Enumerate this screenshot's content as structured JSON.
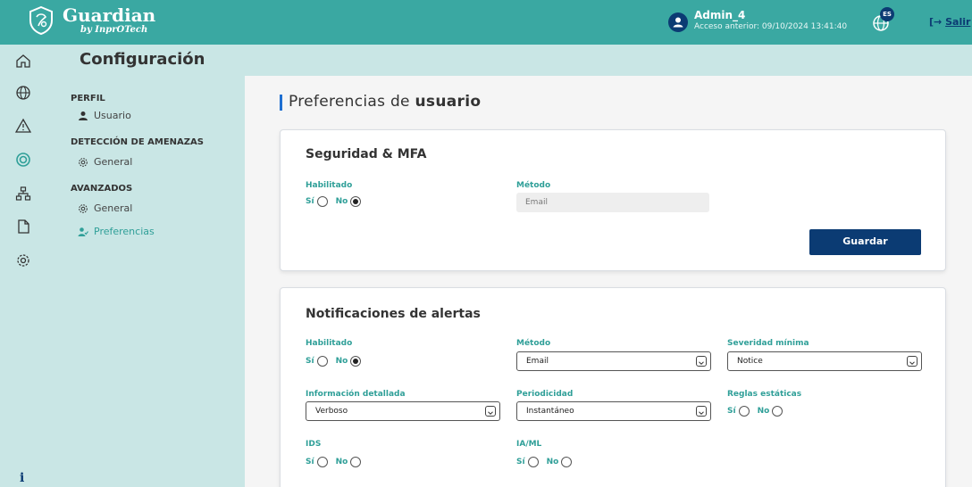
{
  "app": {
    "brand_name": "Guardian",
    "brand_sub": "by InprOTech",
    "user_name": "Admin_4",
    "last_access": "Acceso anterior: 09/10/2024 13:41:40",
    "language_badge": "ES",
    "logout_label": "Salir"
  },
  "rail": {
    "icons": [
      "home-icon",
      "globe-icon",
      "warning-icon",
      "radar-icon",
      "network-icon",
      "document-icon",
      "gear-icon"
    ],
    "info_label": "i"
  },
  "page": {
    "title": "Configuración"
  },
  "sidebar": {
    "perfil": "PERFIL",
    "usuario": "Usuario",
    "deteccion": "DETECCIÓN DE AMENAZAS",
    "deteccion_general": "General",
    "avanzados": "AVANZADOS",
    "avanzados_general": "General",
    "preferencias": "Preferencias"
  },
  "content": {
    "title_prefix": "Preferencias de ",
    "title_bold": "usuario"
  },
  "security": {
    "title": "Seguridad & MFA",
    "habilitado_label": "Habilitado",
    "si": "Sí",
    "no": "No",
    "habilitado_value": "No",
    "metodo_label": "Método",
    "metodo_value": "Email",
    "save_label": "Guardar"
  },
  "alerts": {
    "title": "Notificaciones de alertas",
    "habilitado_label": "Habilitado",
    "habilitado_value": "No",
    "metodo_label": "Método",
    "metodo_value": "Email",
    "severidad_label": "Severidad mínima",
    "severidad_value": "Notice",
    "info_label": "Información detallada",
    "info_value": "Verboso",
    "periodicidad_label": "Periodicidad",
    "periodicidad_value": "Instantáneo",
    "reglas_label": "Reglas estáticas",
    "ids_label": "IDS",
    "iaml_label": "IA/ML",
    "si": "Sí",
    "no": "No"
  },
  "colors": {
    "teal": "#3aa8a2",
    "light_teal": "#c9e6e5",
    "navy": "#0b3b73",
    "accent_text": "#2f9f98"
  }
}
